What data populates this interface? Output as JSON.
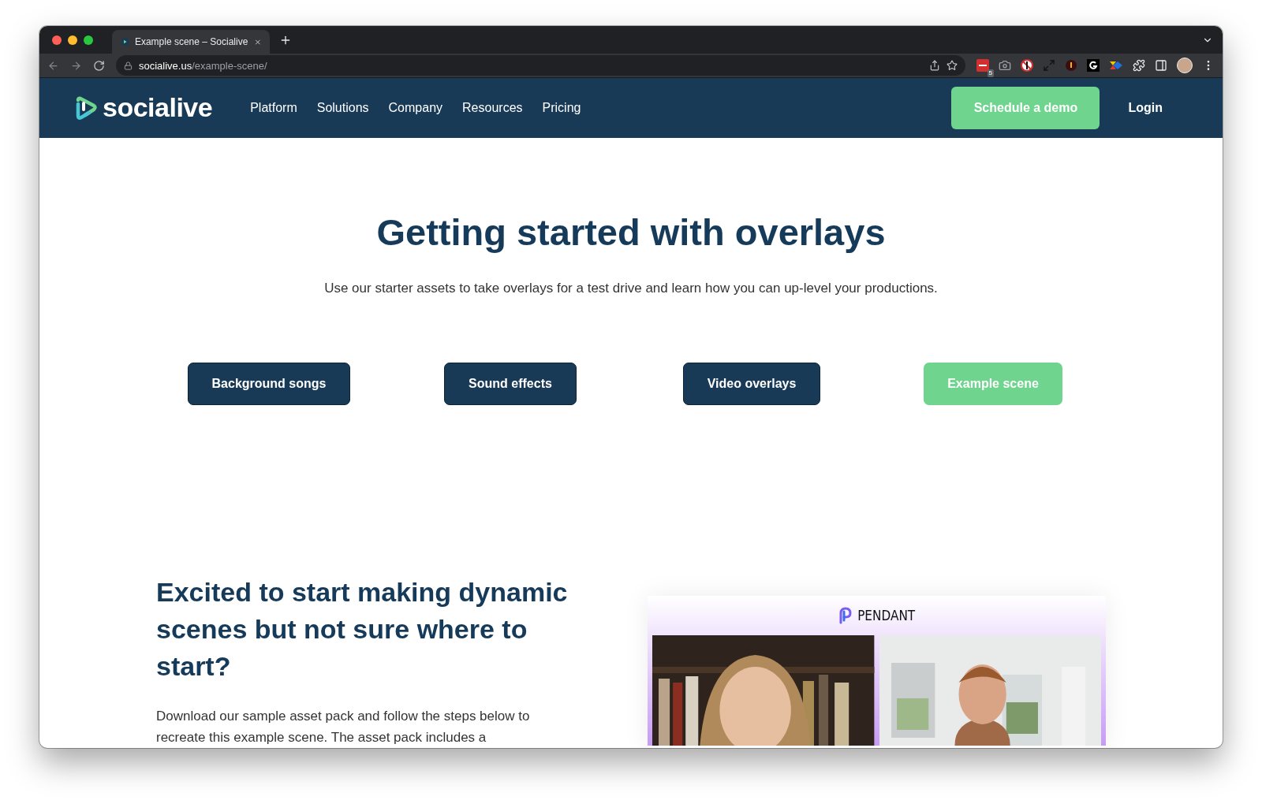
{
  "browser": {
    "tabs": [
      {
        "title": "Example scene – Socialive",
        "selected": true
      }
    ],
    "url": {
      "host": "socialive.us",
      "path": "/example-scene/"
    },
    "extension_badge": "5"
  },
  "nav": {
    "brand": "socialive",
    "links": [
      "Platform",
      "Solutions",
      "Company",
      "Resources",
      "Pricing"
    ],
    "cta": "Schedule a demo",
    "login": "Login"
  },
  "hero": {
    "title": "Getting started with overlays",
    "subtitle": "Use our starter assets to take overlays for a test drive and learn how you can up-level your productions.",
    "buttons": [
      {
        "label": "Background songs",
        "selected": false
      },
      {
        "label": "Sound effects",
        "selected": false
      },
      {
        "label": "Video overlays",
        "selected": false
      },
      {
        "label": "Example scene",
        "selected": true
      }
    ]
  },
  "section": {
    "heading": "Excited to start making dynamic scenes but not sure where to start?",
    "paragraph": "Download our sample asset pack and follow the steps below to recreate this example scene. The asset pack includes a",
    "preview": {
      "brand": "PENDANT"
    }
  }
}
